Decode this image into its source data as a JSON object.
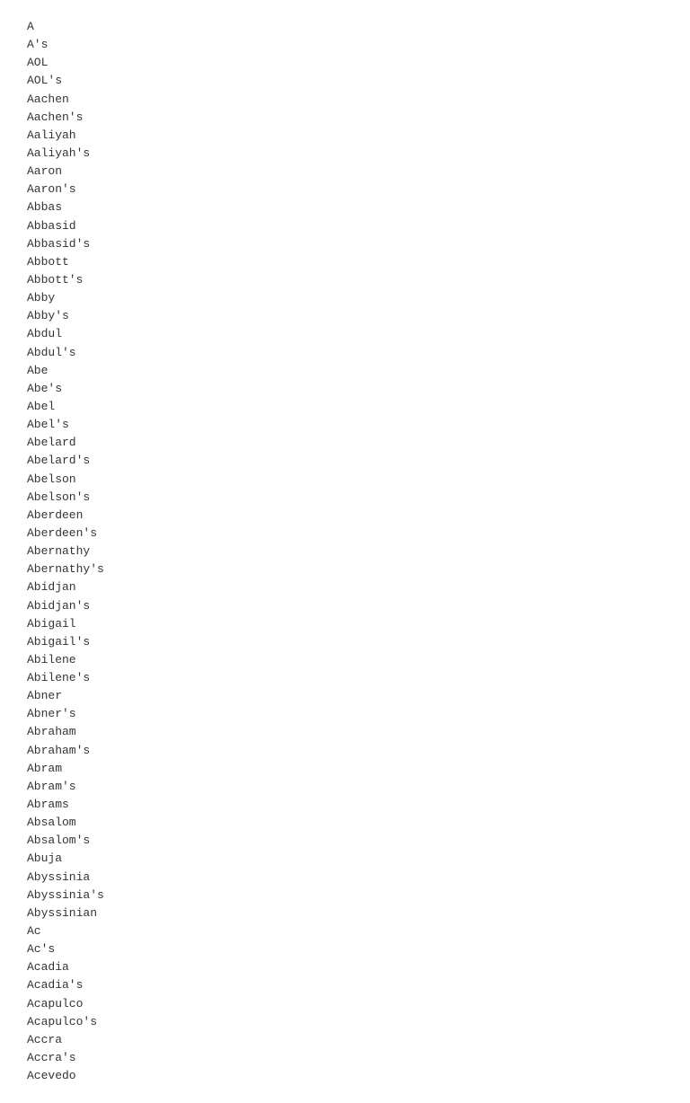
{
  "words": [
    "A",
    "A's",
    "AOL",
    "AOL's",
    "Aachen",
    "Aachen's",
    "Aaliyah",
    "Aaliyah's",
    "Aaron",
    "Aaron's",
    "Abbas",
    "Abbasid",
    "Abbasid's",
    "Abbott",
    "Abbott's",
    "Abby",
    "Abby's",
    "Abdul",
    "Abdul's",
    "Abe",
    "Abe's",
    "Abel",
    "Abel's",
    "Abelard",
    "Abelard's",
    "Abelson",
    "Abelson's",
    "Aberdeen",
    "Aberdeen's",
    "Abernathy",
    "Abernathy's",
    "Abidjan",
    "Abidjan's",
    "Abigail",
    "Abigail's",
    "Abilene",
    "Abilene's",
    "Abner",
    "Abner's",
    "Abraham",
    "Abraham's",
    "Abram",
    "Abram's",
    "Abrams",
    "Absalom",
    "Absalom's",
    "Abuja",
    "Abyssinia",
    "Abyssinia's",
    "Abyssinian",
    "Ac",
    "Ac's",
    "Acadia",
    "Acadia's",
    "Acapulco",
    "Acapulco's",
    "Accra",
    "Accra's",
    "Acevedo"
  ]
}
